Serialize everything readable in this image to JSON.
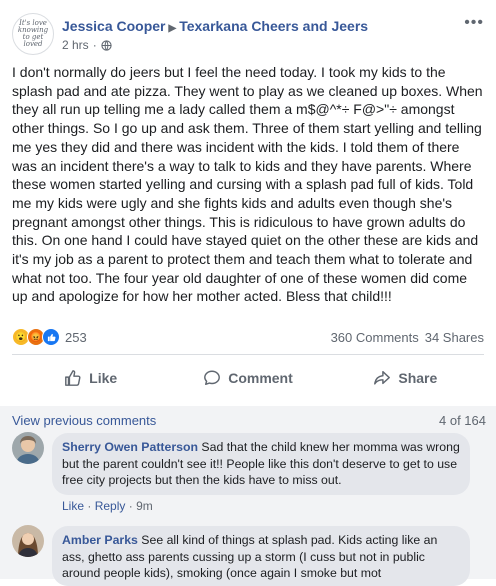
{
  "post": {
    "author": "Jessica Cooper",
    "group": "Texarkana Cheers and Jeers",
    "avatar_text": "It's love knowing to get loved",
    "time": "2 hrs",
    "dot": "·",
    "text": "I don't normally do jeers but I feel the need today. I took my kids to the splash pad and ate pizza. They went to play as we cleaned up boxes. When they all run up telling me a lady called them a m$@^*÷ F@>\"÷ amongst other things. So I go up and ask them. Three of them start yelling and telling me yes they did and there was incident with the kids. I told them of there was an incident there's a way to talk to kids and they have parents. Where these women started yelling and cursing with a splash pad full of kids. Told me my kids were ugly and she fights kids and adults even though she's pregnant amongst other things. This is ridiculous to have grown adults do this. On one hand I could have stayed quiet on the other these are kids and it's my job as a parent to protect them and teach them what to tolerate and what not too. The four year old daughter of one of these women did come up and apologize for how her mother acted. Bless that child!!!"
  },
  "reactions": {
    "count": "253",
    "comments": "360 Comments",
    "shares": "34 Shares"
  },
  "actions": {
    "like": "Like",
    "comment": "Comment",
    "share": "Share"
  },
  "comments_section": {
    "view_previous": "View previous comments",
    "page_count": "4 of 164",
    "items": [
      {
        "name": "Sherry Owen Patterson",
        "text": "Sad that the child knew her momma was wrong but the parent couldn't see it!! People like this don't deserve to get to use free city projects but then the kids have to miss out.",
        "like": "Like",
        "reply": "Reply",
        "sep": "·",
        "time": "9m"
      },
      {
        "name": "Amber Parks",
        "text": "See all kind of things at splash pad. Kids acting like an ass, ghetto ass parents cussing up a storm (I cuss but not in public around people kids), smoking (once again I smoke but mot"
      }
    ]
  },
  "colors": {
    "link": "#385898",
    "secondary_text": "#606770",
    "like_blue": "#1877f2",
    "comment_bubble": "#e4e6eb"
  }
}
